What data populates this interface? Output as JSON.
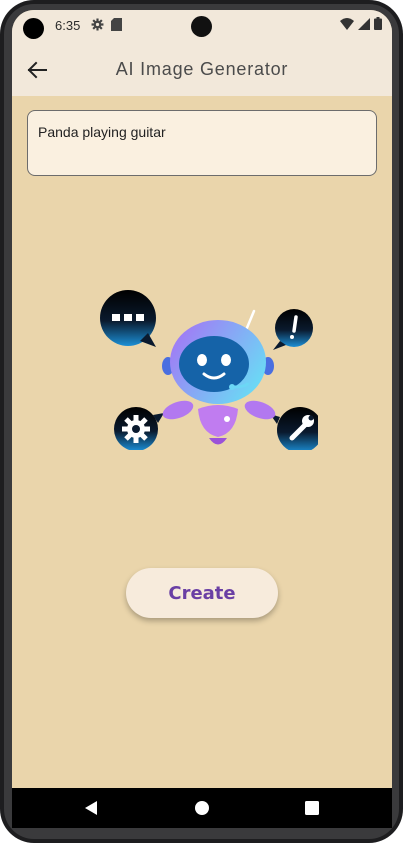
{
  "status_bar": {
    "time": "6:35",
    "left_icons": [
      "gear-icon",
      "sd-card-icon"
    ],
    "right_icons": [
      "wifi-icon",
      "signal-icon",
      "battery-icon"
    ]
  },
  "app_bar": {
    "back_icon": "arrow-left-icon",
    "title": "AI Image Generator"
  },
  "prompt": {
    "value": "Panda playing guitar"
  },
  "illustration": {
    "subject": "robot-mascot",
    "bubble_icons": [
      "chat-dots-icon",
      "exclamation-icon",
      "gear-icon",
      "wrench-icon"
    ]
  },
  "actions": {
    "create_label": "Create"
  },
  "nav_bar": {
    "icons": [
      "back-triangle-icon",
      "home-circle-icon",
      "recents-square-icon"
    ]
  },
  "colors": {
    "background": "#ead5ab",
    "app_bar": "#f2e8da",
    "input_fill": "#faf0e0",
    "button_text": "#6a3fa4",
    "robot_gradient_start": "#a86ef5",
    "robot_gradient_end": "#6cd7f5"
  }
}
